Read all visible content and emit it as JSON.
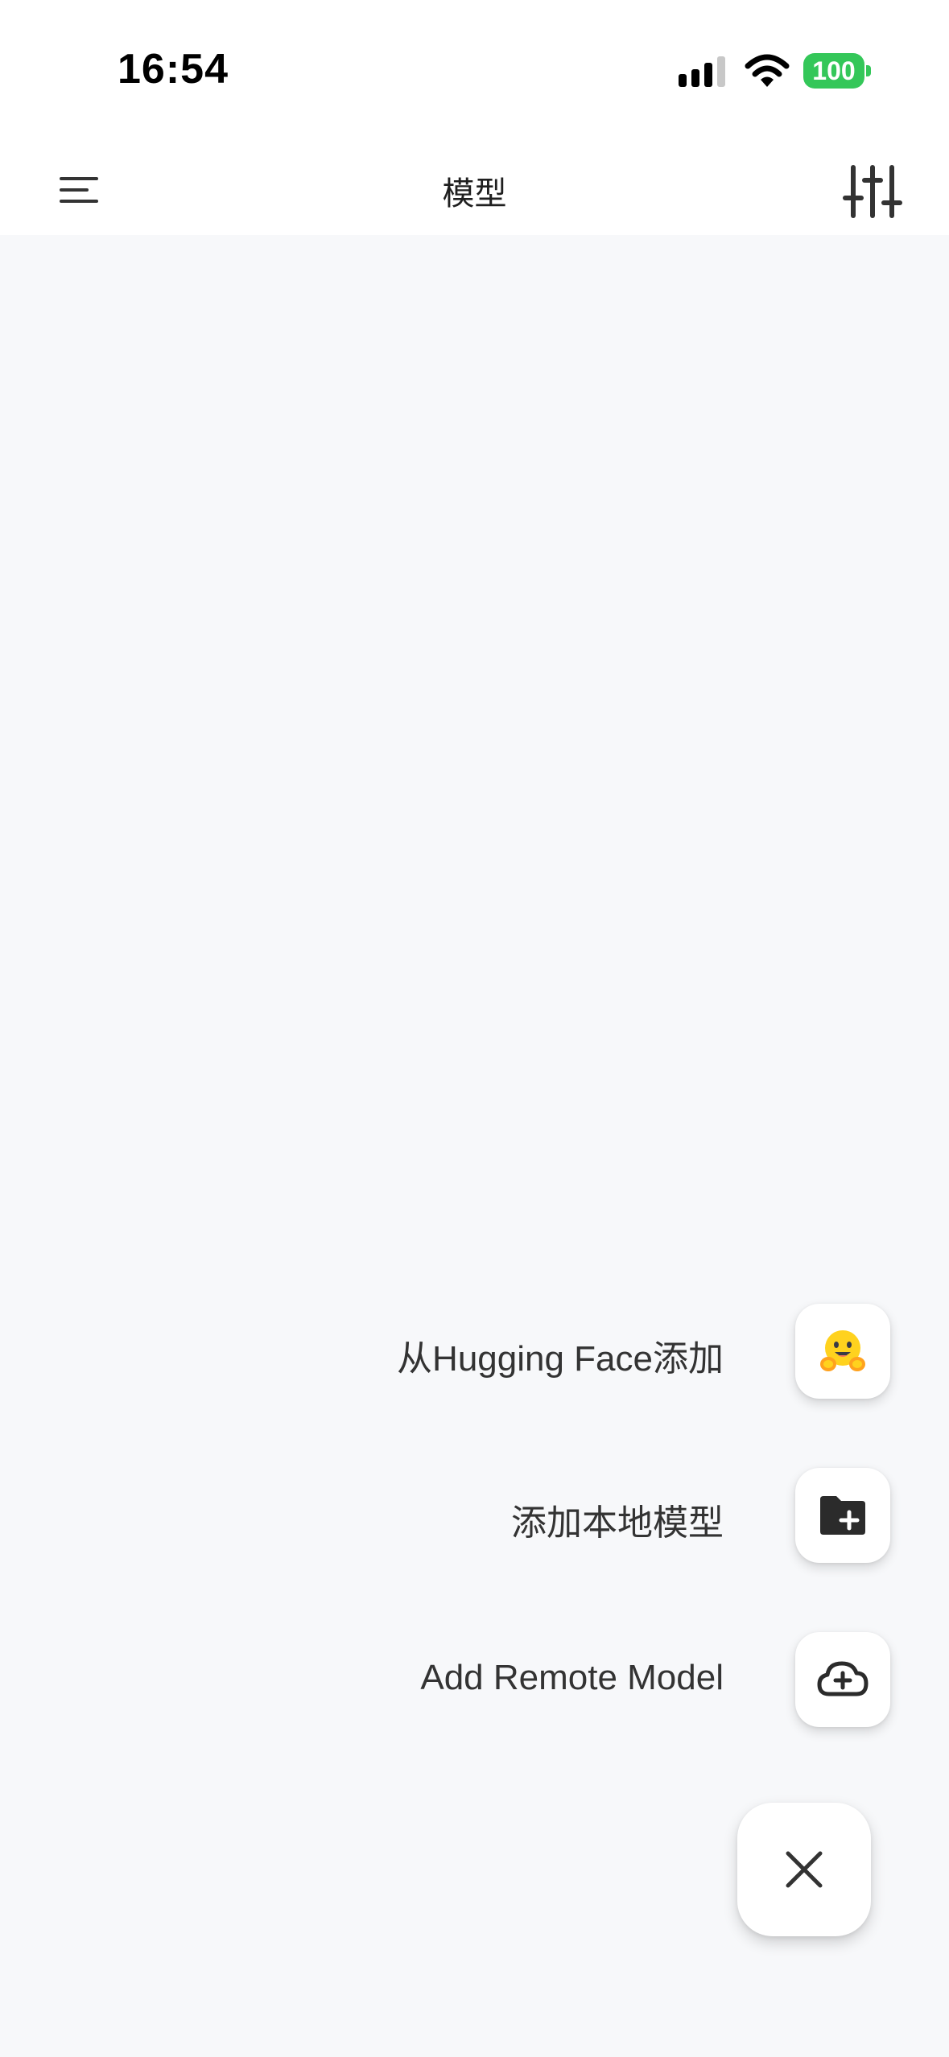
{
  "status_bar": {
    "time": "16:54",
    "battery_level": "100",
    "battery_color": "#34c759"
  },
  "header": {
    "title": "模型",
    "menu_icon": "menu-icon",
    "filter_icon": "sliders-icon"
  },
  "fab_menu": {
    "items": [
      {
        "label": "从Hugging Face添加",
        "icon": "hugging-face-icon"
      },
      {
        "label": "添加本地模型",
        "icon": "folder-plus-icon"
      },
      {
        "label": "Add Remote Model",
        "icon": "cloud-plus-icon"
      }
    ],
    "close_icon": "close-icon"
  }
}
